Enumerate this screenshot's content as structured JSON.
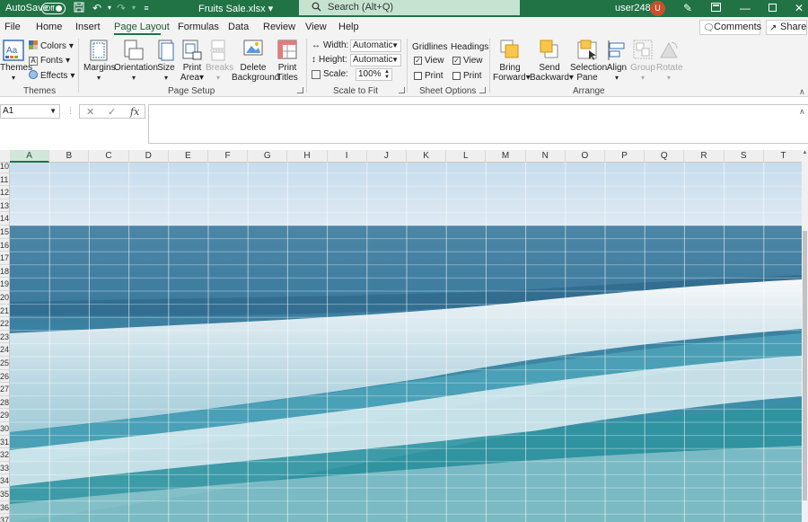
{
  "titlebar": {
    "autosave_label": "AutoSave",
    "autosave_state": "Off",
    "filename": "Fruits Sale.xlsx",
    "search_placeholder": "Search (Alt+Q)",
    "username": "user2480",
    "avatar_initial": "U"
  },
  "menu": {
    "tabs": [
      "File",
      "Home",
      "Insert",
      "Page Layout",
      "Formulas",
      "Data",
      "Review",
      "View",
      "Help"
    ],
    "active": "Page Layout",
    "comments_label": "Comments",
    "share_label": "Share"
  },
  "ribbon": {
    "themes": {
      "themes_label": "Themes",
      "colors_label": "Colors",
      "fonts_label": "Fonts",
      "effects_label": "Effects",
      "group_label": "Themes"
    },
    "page_setup": {
      "margins": "Margins",
      "orientation": "Orientation",
      "size": "Size",
      "print_area_1": "Print",
      "print_area_2": "Area",
      "breaks": "Breaks",
      "delete_bg_1": "Delete",
      "delete_bg_2": "Background",
      "print_titles_1": "Print",
      "print_titles_2": "Titles",
      "group_label": "Page Setup"
    },
    "scale_to_fit": {
      "width_label": "Width:",
      "width_value": "Automatic",
      "height_label": "Height:",
      "height_value": "Automatic",
      "scale_label": "Scale:",
      "scale_value": "100%",
      "group_label": "Scale to Fit"
    },
    "sheet_options": {
      "gridlines_label": "Gridlines",
      "headings_label": "Headings",
      "view_label": "View",
      "print_label": "Print",
      "gridlines_view_checked": true,
      "gridlines_print_checked": false,
      "headings_view_checked": true,
      "headings_print_checked": false,
      "group_label": "Sheet Options"
    },
    "arrange": {
      "bring_forward_1": "Bring",
      "bring_forward_2": "Forward",
      "send_backward_1": "Send",
      "send_backward_2": "Backward",
      "selection_pane_1": "Selection",
      "selection_pane_2": "Pane",
      "align": "Align",
      "group": "Group",
      "rotate": "Rotate",
      "group_label": "Arrange"
    }
  },
  "formula_bar": {
    "name_box": "A1",
    "cancel_symbol": "✕",
    "enter_symbol": "✓",
    "fx_symbol": "fx",
    "formula": ""
  },
  "grid": {
    "columns": [
      "A",
      "B",
      "C",
      "D",
      "E",
      "F",
      "G",
      "H",
      "I",
      "J",
      "K",
      "L",
      "M",
      "N",
      "O",
      "P",
      "Q",
      "R",
      "S",
      "T"
    ],
    "selected_column": "A",
    "rows": [
      "10",
      "11",
      "12",
      "13",
      "14",
      "15",
      "16",
      "17",
      "18",
      "19",
      "20",
      "21",
      "22",
      "23",
      "24",
      "25",
      "26",
      "27",
      "28",
      "29",
      "30",
      "31",
      "32",
      "33",
      "34",
      "35",
      "36",
      "37"
    ],
    "background": "ocean-waves-photo"
  },
  "colors": {
    "excel_green": "#217346",
    "ribbon_bg": "#f3f3f3",
    "avatar": "#c9502a"
  }
}
